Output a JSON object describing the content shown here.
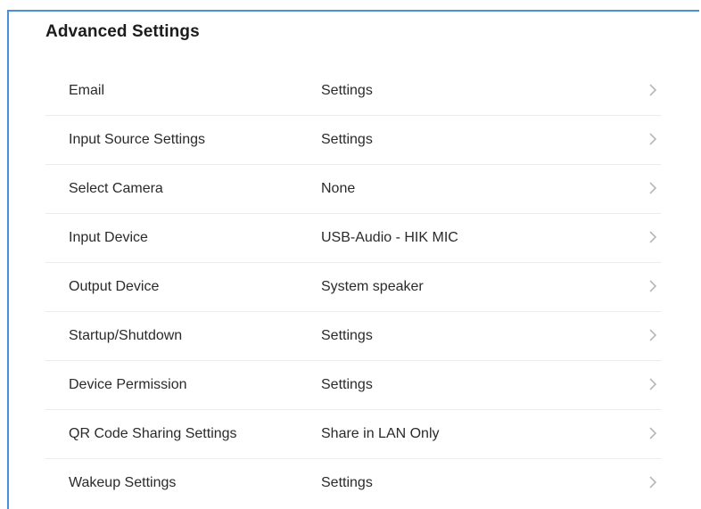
{
  "section": {
    "title": "Advanced Settings"
  },
  "rows": [
    {
      "label": "Email",
      "value": "Settings"
    },
    {
      "label": "Input Source Settings",
      "value": "Settings"
    },
    {
      "label": "Select Camera",
      "value": "None"
    },
    {
      "label": "Input Device",
      "value": "USB-Audio - HIK MIC"
    },
    {
      "label": "Output Device",
      "value": "System speaker"
    },
    {
      "label": "Startup/Shutdown",
      "value": "Settings"
    },
    {
      "label": "Device Permission",
      "value": "Settings"
    },
    {
      "label": "QR Code Sharing Settings",
      "value": "Share in LAN Only"
    },
    {
      "label": "Wakeup Settings",
      "value": "Settings"
    }
  ],
  "icons": {
    "row_chevron": "chevron-right-icon"
  },
  "colors": {
    "frame_border": "#4a8fd8",
    "divider": "#ececec",
    "chevron": "#b8b8b8"
  }
}
